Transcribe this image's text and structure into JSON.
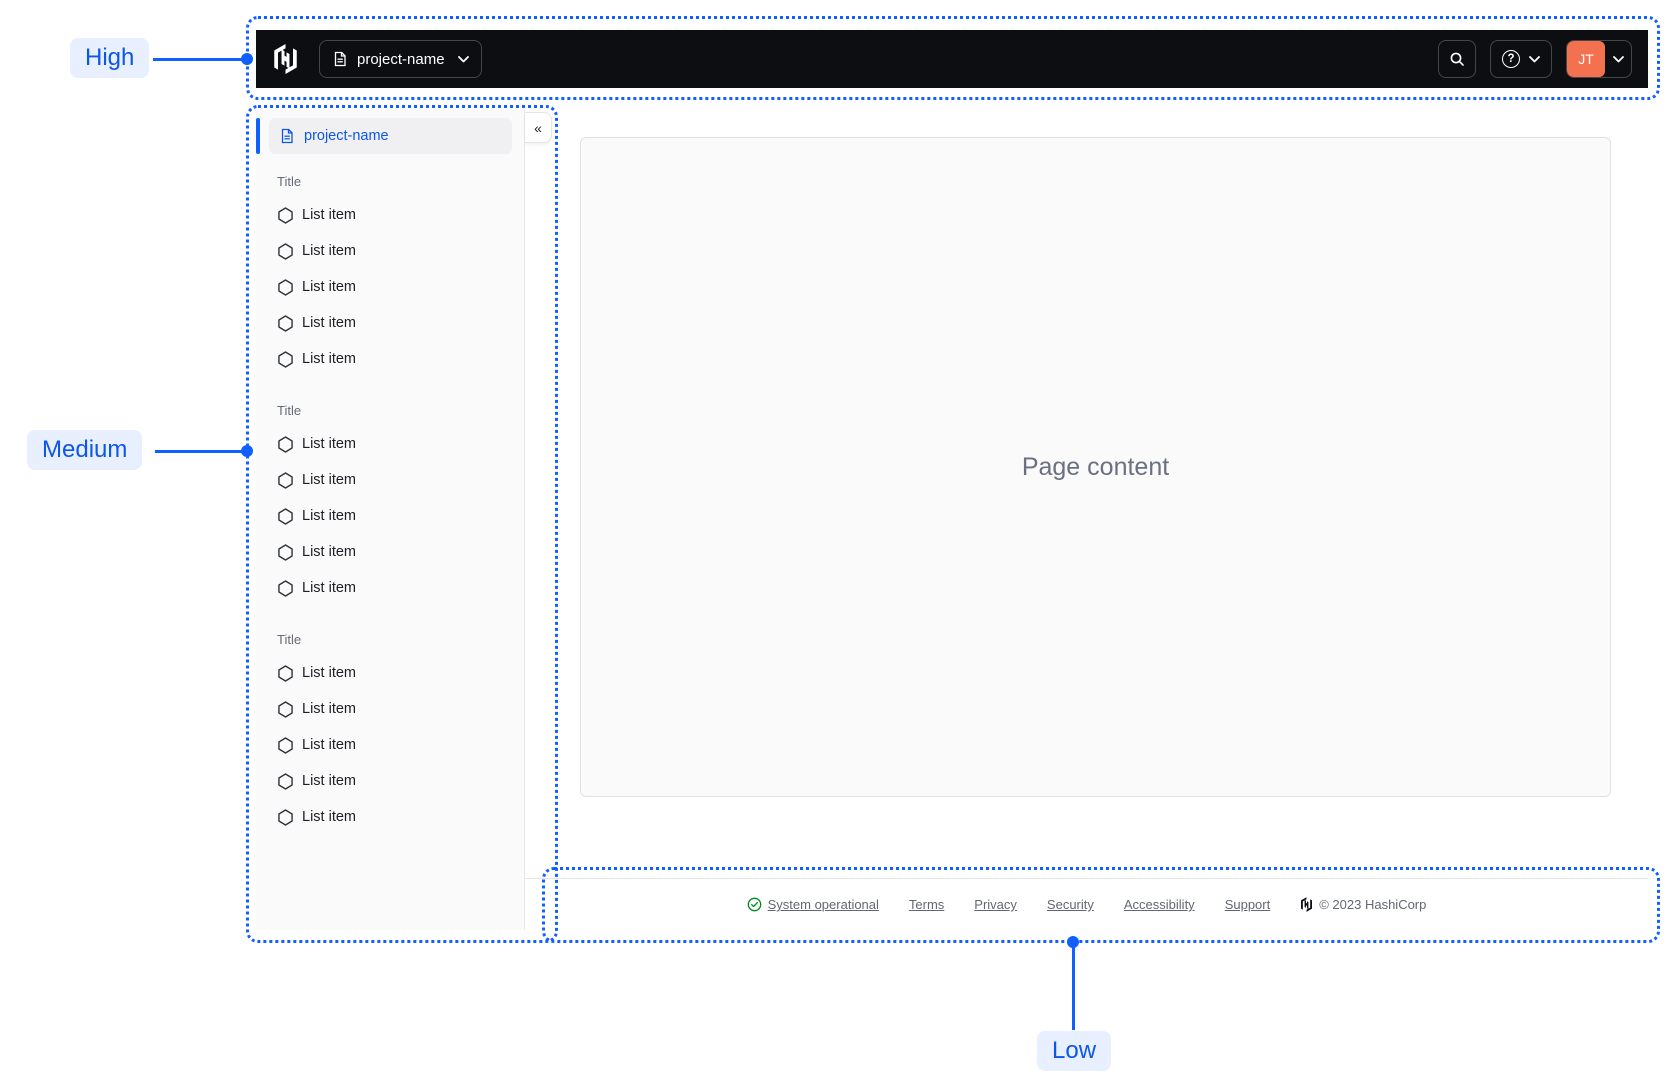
{
  "annotations": {
    "high_label": "High",
    "medium_label": "Medium",
    "low_label": "Low",
    "accent_color": "#1060FF",
    "label_bg": "#E8F0FF"
  },
  "navbar": {
    "logo": "hashicorp-logo",
    "project_dropdown_label": "project-name",
    "search_icon": "search-icon",
    "help_icon": "help-circle-icon",
    "help_glyph": "?",
    "avatar_initials": "JT",
    "avatar_color": "#F4714F",
    "bg_color": "#0D0E12"
  },
  "sidebar": {
    "active_item_label": "project-name",
    "collapse_glyph": "«",
    "item_icon": "hexagon-icon",
    "sections": [
      {
        "title": "Title",
        "items": [
          "List item",
          "List item",
          "List item",
          "List item",
          "List item"
        ]
      },
      {
        "title": "Title",
        "items": [
          "List item",
          "List item",
          "List item",
          "List item",
          "List item"
        ]
      },
      {
        "title": "Title",
        "items": [
          "List item",
          "List item",
          "List item",
          "List item",
          "List item"
        ]
      }
    ]
  },
  "main": {
    "placeholder": "Page content"
  },
  "footer": {
    "status_label": "System operational",
    "status_icon": "check-circle-icon",
    "status_color": "#008A22",
    "links": [
      "Terms",
      "Privacy",
      "Security",
      "Accessibility",
      "Support"
    ],
    "copyright": "© 2023 HashiCorp"
  }
}
